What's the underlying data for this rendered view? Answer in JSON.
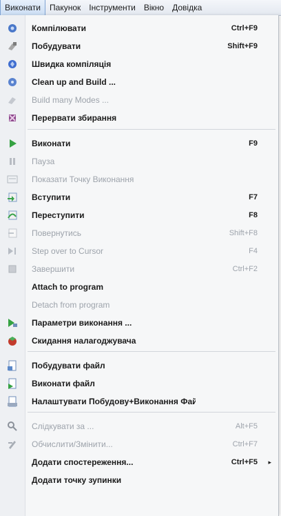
{
  "menubar": [
    "Виконати",
    "Пакунок",
    "Інструменти",
    "Вікно",
    "Довідка"
  ],
  "menu": [
    {
      "label": "Компілювати",
      "shortcut": "Ctrl+F9",
      "icon": "compile-icon",
      "disabled": false
    },
    {
      "label": "Побудувати",
      "shortcut": "Shift+F9",
      "icon": "build-icon",
      "disabled": false
    },
    {
      "label": "Швидка компіляція",
      "shortcut": "",
      "icon": "quick-compile-icon",
      "disabled": false
    },
    {
      "label": "Clean up and Build ...",
      "shortcut": "",
      "icon": "clean-build-icon",
      "disabled": false
    },
    {
      "label": "Build many Modes ...",
      "shortcut": "",
      "icon": "build-modes-icon",
      "disabled": true
    },
    {
      "label": "Перервати збирання",
      "shortcut": "",
      "icon": "abort-build-icon",
      "disabled": false
    },
    {
      "label": "Виконати",
      "shortcut": "F9",
      "icon": "run-icon",
      "disabled": false
    },
    {
      "label": "Пауза",
      "shortcut": "",
      "icon": "pause-icon",
      "disabled": true
    },
    {
      "label": "Показати Точку Виконання",
      "shortcut": "",
      "icon": "show-execution-point-icon",
      "disabled": true
    },
    {
      "label": "Вступити",
      "shortcut": "F7",
      "icon": "step-into-icon",
      "disabled": false
    },
    {
      "label": "Переступити",
      "shortcut": "F8",
      "icon": "step-over-icon",
      "disabled": false
    },
    {
      "label": "Повернутись",
      "shortcut": "Shift+F8",
      "icon": "step-out-icon",
      "disabled": true
    },
    {
      "label": "Step over to Cursor",
      "shortcut": "F4",
      "icon": "run-to-cursor-icon",
      "disabled": true
    },
    {
      "label": "Завершити",
      "shortcut": "Ctrl+F2",
      "icon": "stop-icon",
      "disabled": true
    },
    {
      "label": "Attach to program",
      "shortcut": "",
      "icon": "",
      "disabled": false
    },
    {
      "label": "Detach from program",
      "shortcut": "",
      "icon": "",
      "disabled": true
    },
    {
      "label": "Параметри виконання ...",
      "shortcut": "",
      "icon": "run-parameters-icon",
      "disabled": false
    },
    {
      "label": "Скидання налагоджувача",
      "shortcut": "",
      "icon": "reset-debugger-icon",
      "disabled": false
    },
    {
      "label": "Побудувати файл",
      "shortcut": "",
      "icon": "build-file-icon",
      "disabled": false
    },
    {
      "label": "Виконати файл",
      "shortcut": "",
      "icon": "run-file-icon",
      "disabled": false
    },
    {
      "label": "Налаштувати Побудову+Виконання Файлу ...",
      "shortcut": "",
      "icon": "configure-build-run-icon",
      "disabled": false
    },
    {
      "label": "Слідкувати за ...",
      "shortcut": "Alt+F5",
      "icon": "inspect-icon",
      "disabled": true
    },
    {
      "label": "Обчислити/Змінити...",
      "shortcut": "Ctrl+F7",
      "icon": "evaluate-modify-icon",
      "disabled": true
    },
    {
      "label": "Додати спостереження...",
      "shortcut": "Ctrl+F5",
      "icon": "",
      "disabled": false
    },
    {
      "label": "Додати точку зупинки",
      "shortcut": "",
      "icon": "",
      "disabled": false
    }
  ]
}
